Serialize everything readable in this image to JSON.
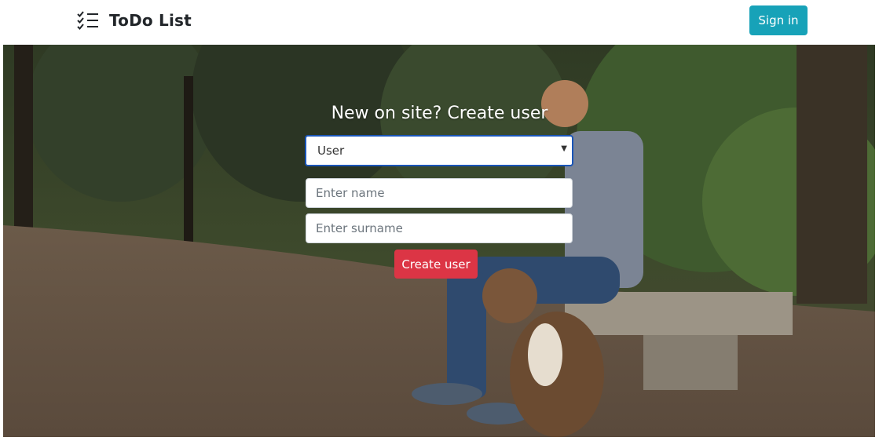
{
  "navbar": {
    "brand_name": "ToDo List",
    "brand_icon": "checklist-icon",
    "signin_label": "Sign in"
  },
  "hero": {
    "background": "photo-man-with-dog-on-bench",
    "form_title": "New on site? Create user",
    "role_select": {
      "selected": "User",
      "options": [
        "User"
      ]
    },
    "name_placeholder": "Enter name",
    "surname_placeholder": "Enter surname",
    "create_label": "Create user"
  },
  "colors": {
    "signin_button": "#17a2b8",
    "create_button": "#dc3545",
    "select_focus_border": "#1a55b8"
  }
}
